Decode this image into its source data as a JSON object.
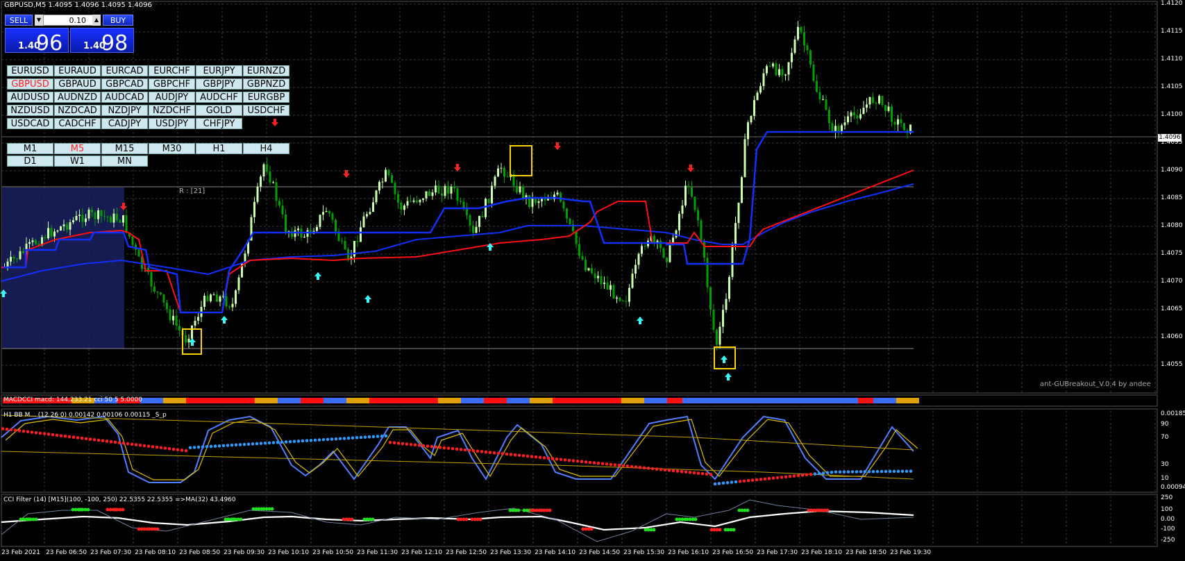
{
  "window": {
    "title": "GBPUSD,M5  1.4095 1.4096 1.4095 1.4096"
  },
  "trade_panel": {
    "sell_label": "SELL",
    "buy_label": "BUY",
    "lot_value": "0.10",
    "sell_price_small": "1.40",
    "sell_price_big": "96",
    "buy_price_small": "1.40",
    "buy_price_big": "98"
  },
  "symbols": [
    [
      "EURUSD",
      "EURAUD",
      "EURCAD",
      "EURCHF",
      "EURJPY",
      "EURNZD"
    ],
    [
      "GBPUSD",
      "GBPAUD",
      "GBPCAD",
      "GBPCHF",
      "GBPJPY",
      "GBPNZD"
    ],
    [
      "AUDUSD",
      "AUDNZD",
      "AUDCAD",
      "AUDJPY",
      "AUDCHF",
      "EURGBP"
    ],
    [
      "NZDUSD",
      "NZDCAD",
      "NZDJPY",
      "NZDCHF",
      "GOLD",
      "USDCHF"
    ],
    [
      "USDCAD",
      "CADCHF",
      "CADJPY",
      "USDJPY",
      "CHFJPY"
    ]
  ],
  "active_symbol": "GBPUSD",
  "timeframes": [
    [
      "M1",
      "M5",
      "M15",
      "M30",
      "H1",
      "H4"
    ],
    [
      "D1",
      "W1",
      "MN"
    ]
  ],
  "active_timeframe": "M5",
  "range_label": "R : [21]",
  "indicator_credit": "ant-GUBreakout_V.0.4 by andee",
  "current_price_tag": "1.4096",
  "price_axis": [
    "1.4120",
    "1.4115",
    "1.4110",
    "1.4105",
    "1.4100",
    "1.4095",
    "1.4090",
    "1.4085",
    "1.4080",
    "1.4075",
    "1.4070",
    "1.4065",
    "1.4060",
    "1.4055"
  ],
  "time_axis": [
    "23 Feb 2021",
    "23 Feb 06:50",
    "23 Feb 07:30",
    "23 Feb 08:10",
    "23 Feb 08:50",
    "23 Feb 09:30",
    "23 Feb 10:10",
    "23 Feb 10:50",
    "23 Feb 11:30",
    "23 Feb 12:10",
    "23 Feb 12:50",
    "23 Feb 13:30",
    "23 Feb 14:10",
    "23 Feb 14:50",
    "23 Feb 15:30",
    "23 Feb 16:10",
    "23 Feb 16:50",
    "23 Feb 17:30",
    "23 Feb 18:10",
    "23 Feb 18:50",
    "23 Feb 19:30"
  ],
  "macdcci_label": "MACDCCI macd: 144.233.21 cci 50 5 5.0000",
  "stoch_label": "H1 BB M... (12 26 0) 0.00142 0.00106 0.00115 _S_p",
  "stoch_axis": [
    "0.00185",
    "90",
    "70",
    "30",
    "10",
    "0.00094"
  ],
  "cci_label": "CCI Filter (14) [M15](100, -100, 250) 22.5355 22.5355  =>MA(32) 43.4960",
  "cci_axis": [
    "250",
    "100",
    "0.00",
    "-100",
    "-250"
  ],
  "colors": {
    "bull": "#ccffaa",
    "bear": "#00a000",
    "ma_blue": "#1030ff",
    "ma_red": "#ff1010",
    "grid": "#3a3a3a",
    "box": "#ffd400"
  }
}
